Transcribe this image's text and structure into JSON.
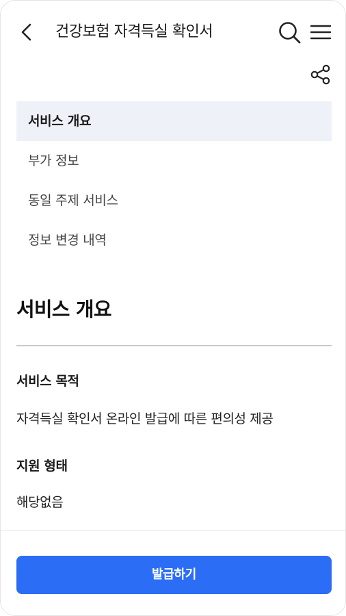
{
  "header": {
    "title": "건강보험 자격득실 확인서",
    "back_icon": "chevron-left-icon",
    "search_icon": "search-icon",
    "menu_icon": "hamburger-menu-icon",
    "share_icon": "share-icon"
  },
  "toc": {
    "items": [
      {
        "label": "서비스 개요",
        "active": true
      },
      {
        "label": "부가 정보",
        "active": false
      },
      {
        "label": "동일 주제 서비스",
        "active": false
      },
      {
        "label": "정보 변경 내역",
        "active": false
      }
    ]
  },
  "section": {
    "title": "서비스 개요",
    "fields": [
      {
        "label": "서비스 목적",
        "value": "자격득실 확인서 온라인 발급에 따른 편의성 제공"
      },
      {
        "label": "지원 형태",
        "value": "해당없음"
      }
    ]
  },
  "footer": {
    "issue_button_label": "발급하기",
    "accent_color": "#2b6df5"
  }
}
